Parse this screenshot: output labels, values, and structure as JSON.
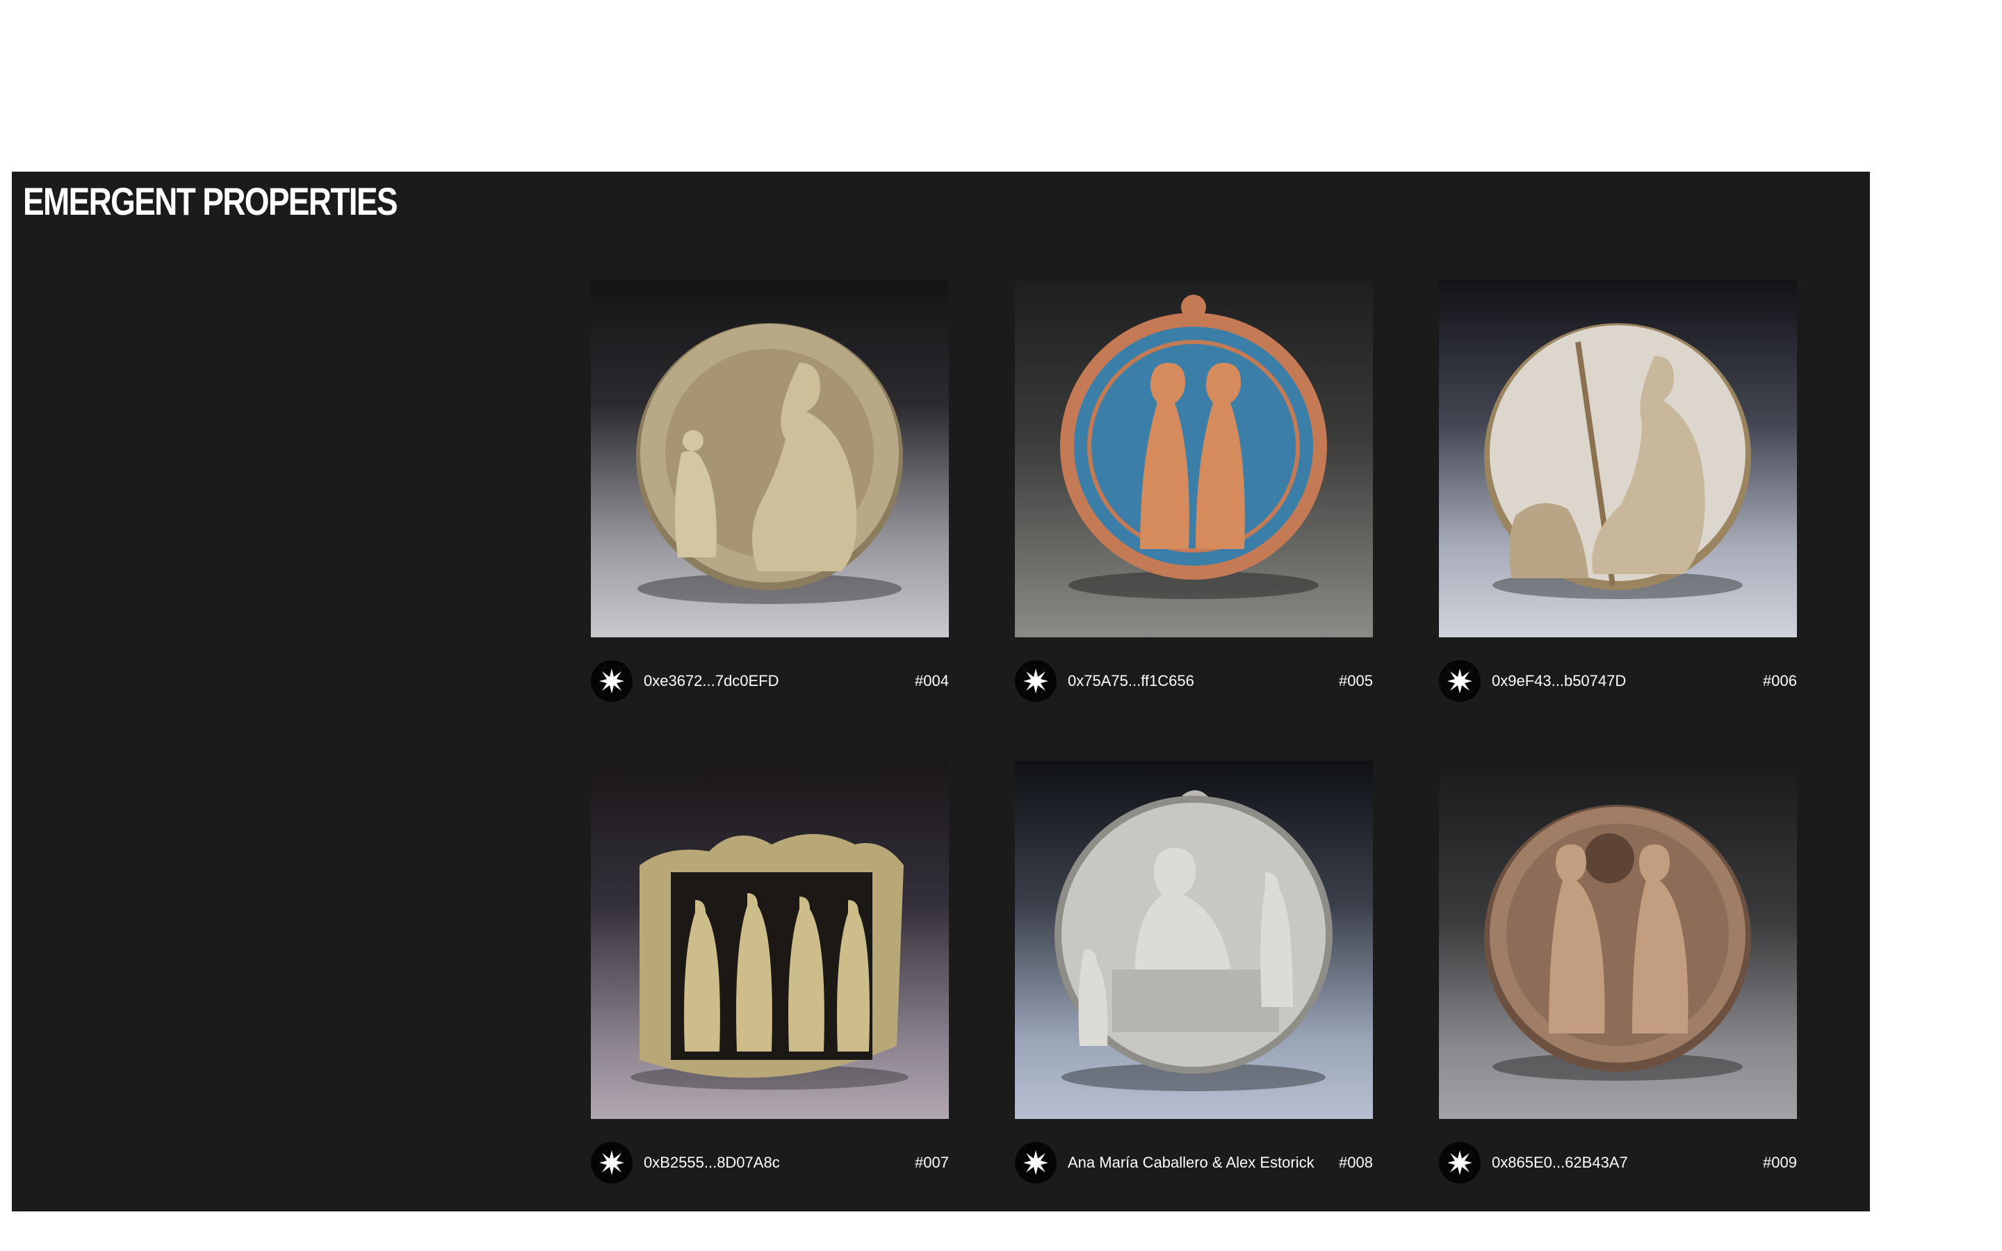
{
  "section": {
    "title": "EMERGENT PROPERTIES"
  },
  "items": [
    {
      "owner": "0xe3672...7dc0EFD",
      "number": "#004",
      "avatar_icon": "starburst-icon",
      "image": "bronze-medal-seated-woman-child-icon"
    },
    {
      "owner": "0x75A75...ff1C656",
      "number": "#005",
      "avatar_icon": "starburst-icon",
      "image": "enamel-medal-two-figures-icon"
    },
    {
      "owner": "0x9eF43...b50747D",
      "number": "#006",
      "avatar_icon": "starburst-icon",
      "image": "silver-medal-spinner-icon"
    },
    {
      "owner": "0xB2555...8D07A8c",
      "number": "#007",
      "avatar_icon": "starburst-icon",
      "image": "gold-relief-four-figures-icon"
    },
    {
      "owner": "Ana María Caballero & Alex Estorick",
      "number": "#008",
      "avatar_icon": "starburst-icon",
      "image": "silver-medal-scribe-icon"
    },
    {
      "owner": "0x865E0...62B43A7",
      "number": "#009",
      "avatar_icon": "starburst-icon",
      "image": "copper-medal-two-women-icon"
    }
  ]
}
